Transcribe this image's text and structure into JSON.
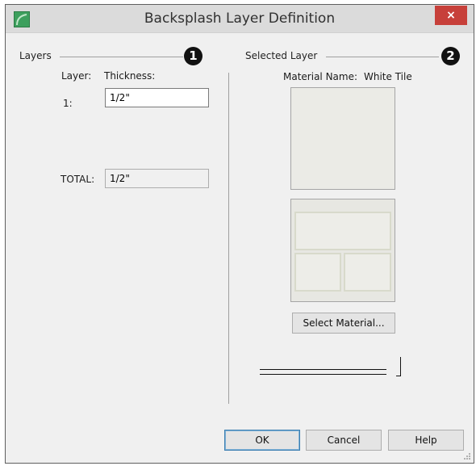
{
  "window": {
    "title": "Backsplash Layer Definition",
    "close_glyph": "×",
    "app_icon": "chief-architect-icon"
  },
  "layers_section": {
    "label": "Layers",
    "callout": "1",
    "layer_header": "Layer:",
    "thickness_header": "Thickness:",
    "rows": [
      {
        "index_label": "1:",
        "thickness": "1/2\""
      }
    ],
    "total_label": "TOTAL:",
    "total_value": "1/2\""
  },
  "selected_section": {
    "label": "Selected Layer",
    "callout": "2",
    "material_name_label": "Material Name:",
    "material_name": "White Tile",
    "select_material_label": "Select Material..."
  },
  "buttons": {
    "ok": "OK",
    "cancel": "Cancel",
    "help": "Help"
  },
  "colors": {
    "close_button": "#c7403a",
    "tile": "#ededE8",
    "grout": "#d8dacb"
  }
}
